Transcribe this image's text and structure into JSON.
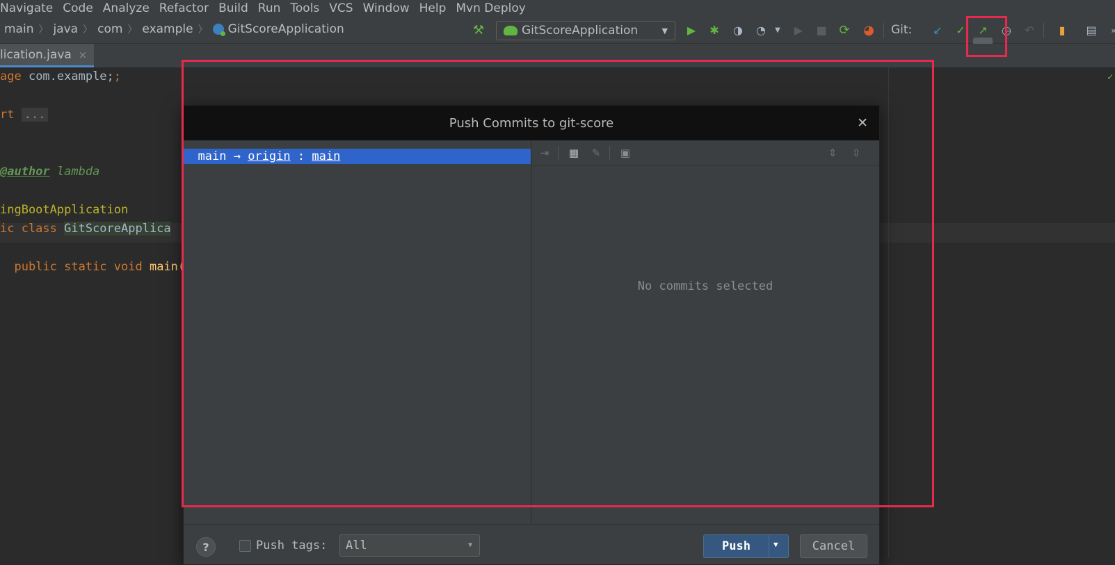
{
  "menu": [
    "Navigate",
    "Code",
    "Analyze",
    "Refactor",
    "Build",
    "Run",
    "Tools",
    "VCS",
    "Window",
    "Help",
    "Mvn Deploy"
  ],
  "breadcrumbs": [
    "main",
    "java",
    "com",
    "example",
    "GitScoreApplication"
  ],
  "run_config": "GitScoreApplication",
  "git_label": "Git:",
  "editor_tab": {
    "filename": "lication.java",
    "close": "×"
  },
  "code": {
    "l1_kw": "age",
    "l1_rest": " com.example;",
    "l2_kw": "rt",
    "l2_fold": "...",
    "l3_tag": "author",
    "l3_rest": " lambda",
    "l4_ann": "ingBootApplication",
    "l5_kw": "ic class ",
    "l5_cls": "GitScoreApplica",
    "l6_kw": "public static void ",
    "l6_fn": "main("
  },
  "dialog": {
    "title": "Push Commits to git-score",
    "close": "✕",
    "branch_local": "main",
    "arrow": "→",
    "remote": "origin",
    "colon": ":",
    "branch_remote": "main",
    "empty_message": "No commits selected",
    "help": "?",
    "push_tags_label": "Push tags:",
    "tags_value": "All",
    "push_label": "Push",
    "cancel_label": "Cancel"
  },
  "colors": {
    "accent": "#2f65ca",
    "annotation": "#e8294e",
    "push_button": "#365880"
  }
}
